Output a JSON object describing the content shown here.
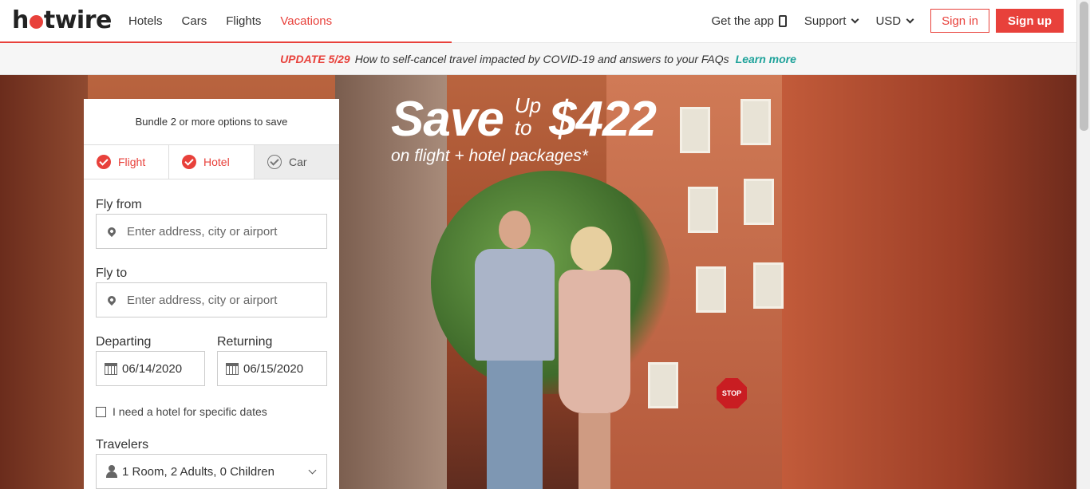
{
  "header": {
    "logo_text": "hotwire",
    "nav": [
      {
        "label": "Hotels",
        "active": false
      },
      {
        "label": "Cars",
        "active": false
      },
      {
        "label": "Flights",
        "active": false
      },
      {
        "label": "Vacations",
        "active": true
      }
    ],
    "get_app": "Get the app",
    "support": "Support",
    "currency": "USD",
    "signin": "Sign in",
    "signup": "Sign up"
  },
  "banner": {
    "update": "UPDATE 5/29",
    "message": "How to self-cancel travel impacted by COVID-19 and answers to your FAQs",
    "learn_more": "Learn more"
  },
  "promo": {
    "save": "Save",
    "up": "Up",
    "to": "to",
    "amount": "$422",
    "subtitle": "on flight + hotel packages*"
  },
  "search": {
    "bundle_text": "Bundle 2 or more options to save",
    "options": [
      {
        "label": "Flight",
        "selected": true
      },
      {
        "label": "Hotel",
        "selected": true
      },
      {
        "label": "Car",
        "selected": false
      }
    ],
    "fly_from_label": "Fly from",
    "fly_from_placeholder": "Enter address, city or airport",
    "fly_to_label": "Fly to",
    "fly_to_placeholder": "Enter address, city or airport",
    "departing_label": "Departing",
    "departing_value": "06/14/2020",
    "returning_label": "Returning",
    "returning_value": "06/15/2020",
    "hotel_dates_label": "I need a hotel for specific dates",
    "travelers_label": "Travelers",
    "travelers_value": "1 Room, 2 Adults, 0 Children"
  },
  "colors": {
    "brand_red": "#e8413b",
    "teal": "#1ea29a"
  },
  "icons": [
    "phone-icon",
    "chevron-down-icon",
    "check-circle-icon",
    "location-pin-icon",
    "calendar-icon",
    "person-icon"
  ]
}
